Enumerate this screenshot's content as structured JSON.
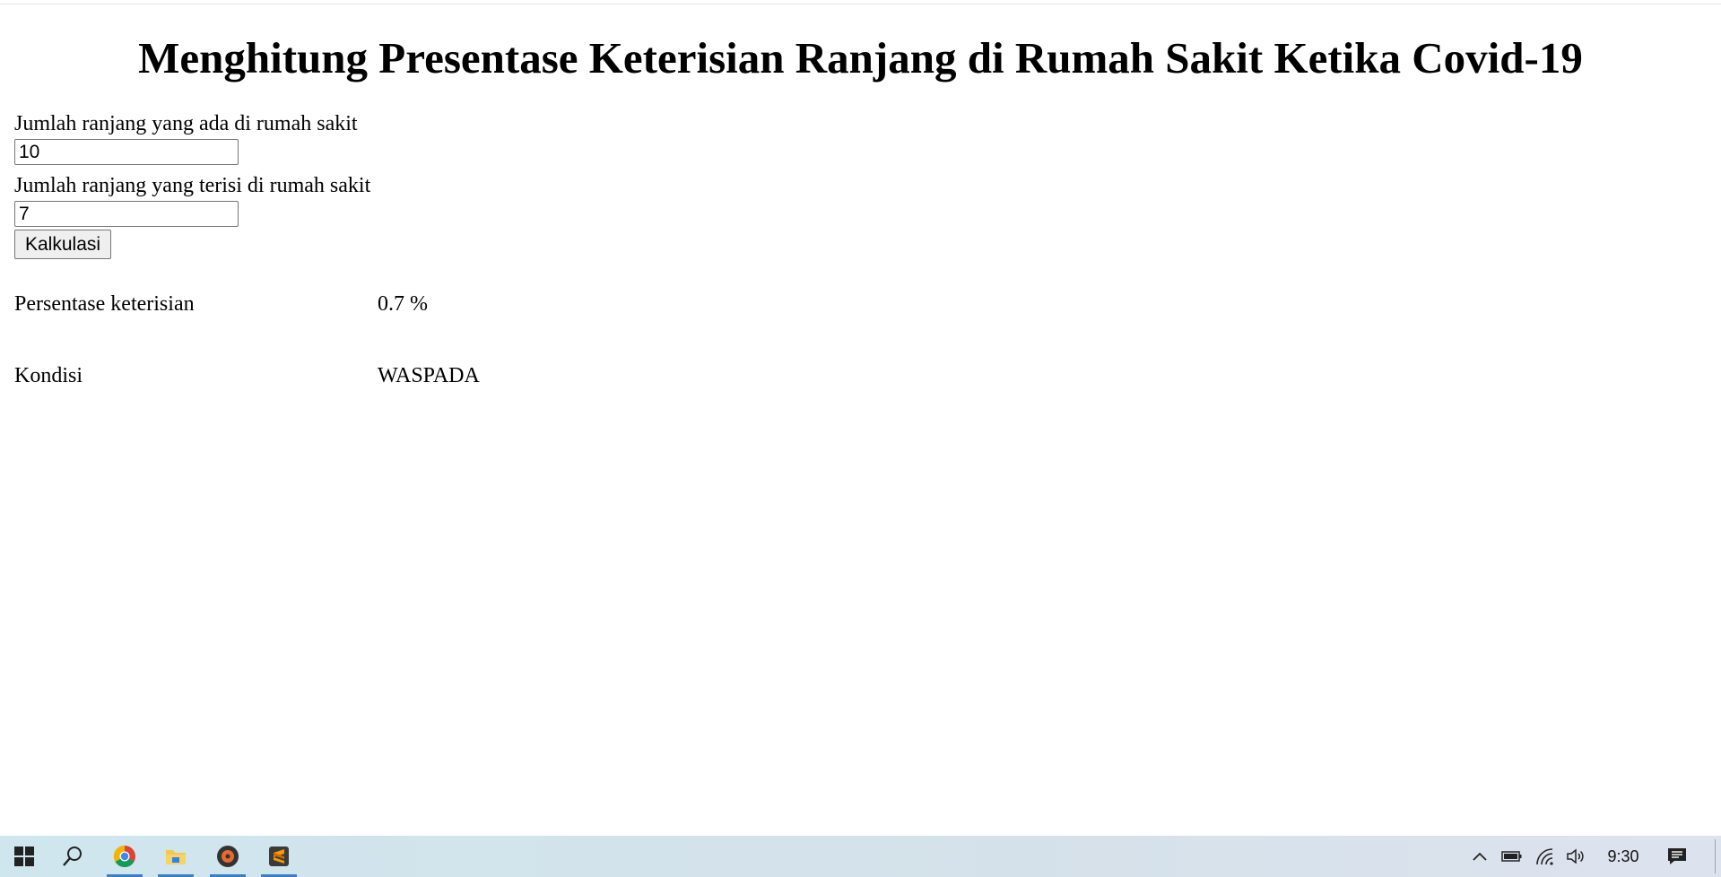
{
  "page": {
    "title": "Menghitung Presentase Keterisian Ranjang di Rumah Sakit Ketika Covid-19"
  },
  "form": {
    "total_beds_label": "Jumlah ranjang yang ada di rumah sakit",
    "total_beds_value": "10",
    "occupied_beds_label": "Jumlah ranjang yang terisi di rumah sakit",
    "occupied_beds_value": "7",
    "calculate_label": "Kalkulasi"
  },
  "results": {
    "percentage_label": "Persentase keterisian",
    "percentage_value": "0.7 %",
    "condition_label": "Kondisi",
    "condition_value": "WASPADA"
  },
  "taskbar": {
    "apps": [
      {
        "icon": "windows-start-icon"
      },
      {
        "icon": "search-icon"
      },
      {
        "icon": "chrome-icon",
        "running": true
      },
      {
        "icon": "file-explorer-icon",
        "running": true
      },
      {
        "icon": "media-player-icon",
        "running": true
      },
      {
        "icon": "sublime-text-icon",
        "running": true
      }
    ],
    "tray_icons": [
      "chevron-up-icon",
      "battery-icon",
      "wifi-icon",
      "volume-icon"
    ],
    "clock": "9:30",
    "notification_icon": "action-center-icon"
  }
}
